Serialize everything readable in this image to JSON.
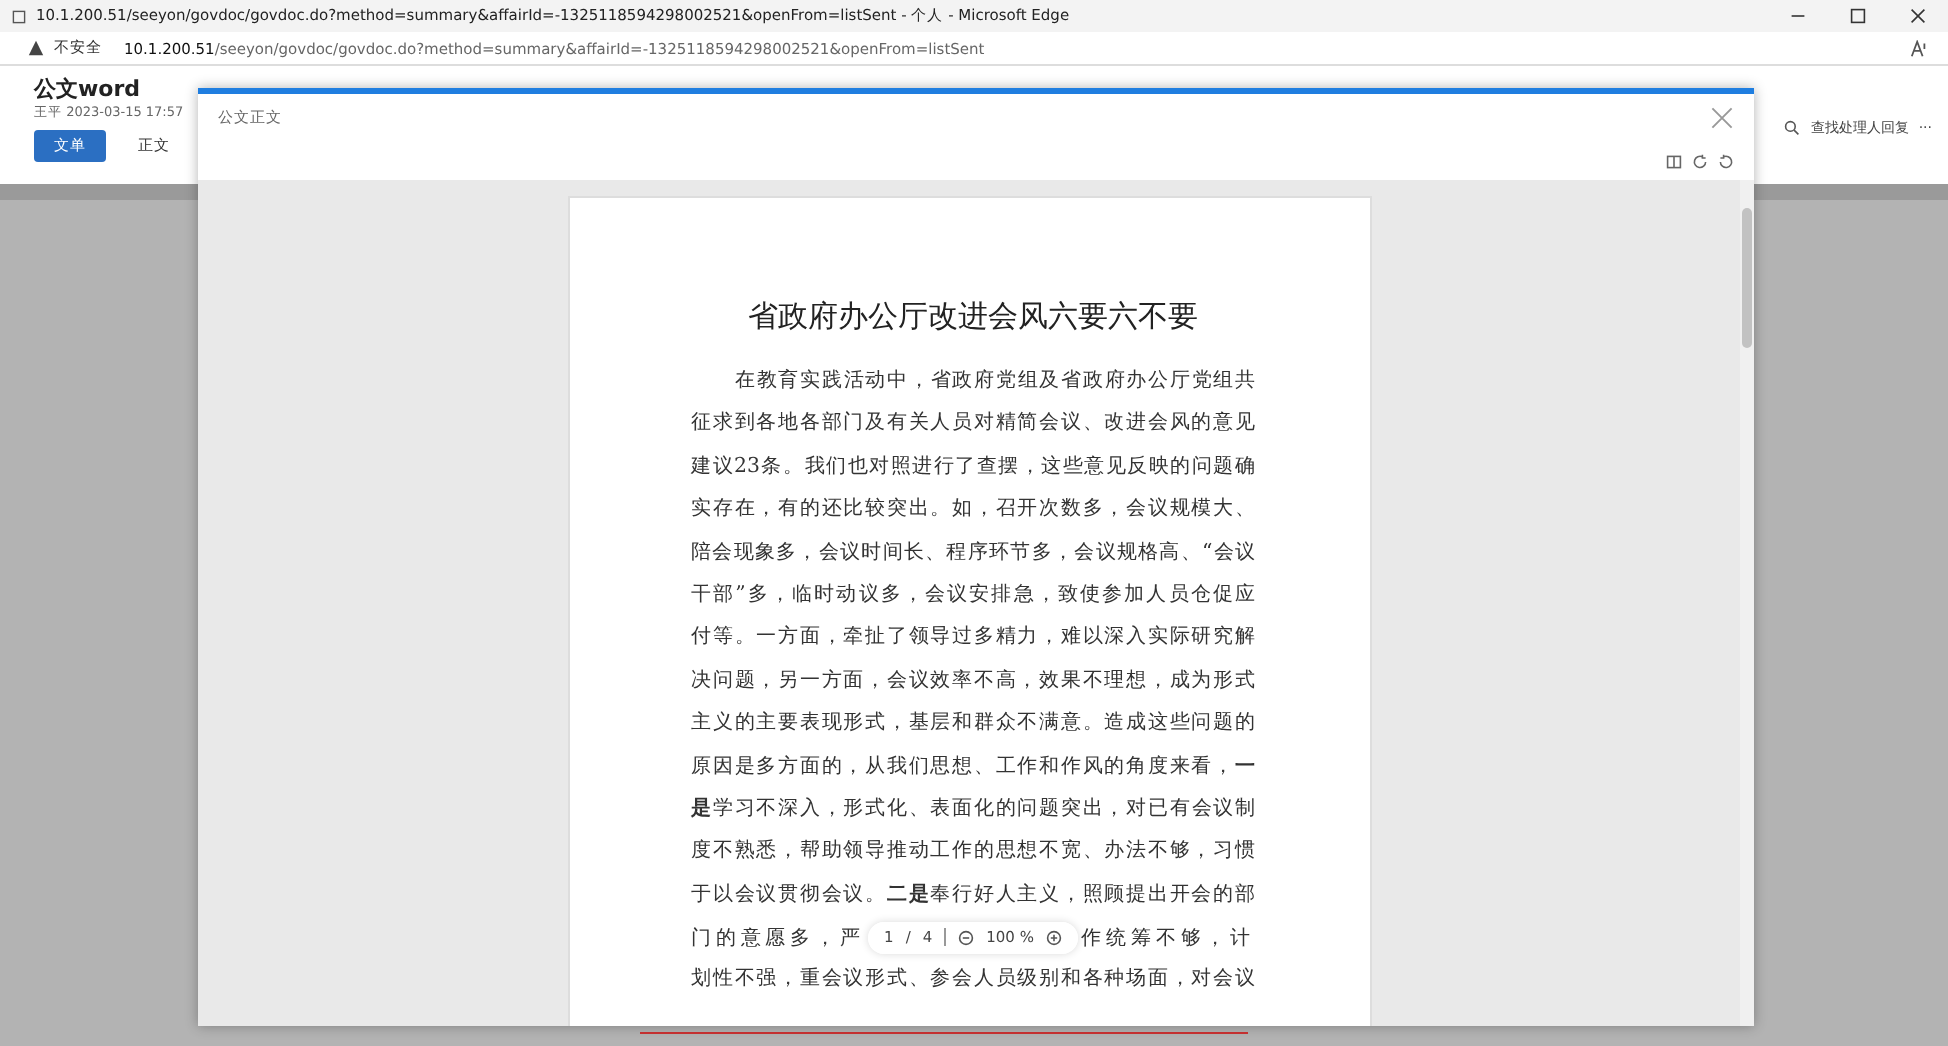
{
  "browser": {
    "title": "10.1.200.51/seeyon/govdoc/govdoc.do?method=summary&affairId=-1325118594298002521&openFrom=listSent - 个人 - Microsoft Edge",
    "security": "不安全",
    "url_host": "10.1.200.51",
    "url_path": "/seeyon/govdoc/govdoc.do?method=summary&affairId=-1325118594298002521&openFrom=listSent"
  },
  "page": {
    "title": "公文word",
    "meta": "王平 2023-03-15 17:57",
    "tabs": [
      {
        "label": "文单",
        "selected": true
      },
      {
        "label": "正文",
        "selected": false
      }
    ],
    "search_label": "查找处理人回复",
    "more": "···"
  },
  "dialog": {
    "title": "公文正文",
    "document": {
      "heading": "省政府办公厅改进会风六要六不要",
      "lines_before": [
        "在教育实践活动中，省政府党组及省政府办公厅党组共",
        "征求到各地各部门及有关人员对精简会议、改进会风的意见",
        "建议23条。我们也对照进行了查摆，这些意见反映的问题确",
        "实存在，有的还比较突出。如，召开次数多，会议规模大、",
        "陪会现象多，会议时间长、程序环节多，会议规格高、“会议",
        "干部”多，临时动议多，会议安排急，致使参加人员仓促应",
        "付等。一方面，牵扯了领导过多精力，难以深入实际研究解",
        "决问题，另一方面，会议效率不高，效果不理想，成为形式",
        "主义的主要表现形式，基层和群众不满意。造成这些问题的",
        "原因是多方面的，从我们思想、工作和作风的角度来看，**一**",
        "**是**学习不深入，形式化、表面化的问题突出，对已有会议制",
        "度不熟悉，帮助领导推动工作的思想不宽、办法不够，习惯",
        "于以会议贯彻会议。**二是**奉行好人主义，照顾提出开会的部"
      ],
      "covered_line": {
        "before": "门的意愿多，严",
        "after": "作统筹不够，计"
      },
      "lines_after": [
        "划性不强，重会议形式、参会人员级别和各种场面，对会议"
      ]
    },
    "pager": {
      "page": "1",
      "separator": "/",
      "total": "4",
      "zoom": "100 %"
    }
  }
}
